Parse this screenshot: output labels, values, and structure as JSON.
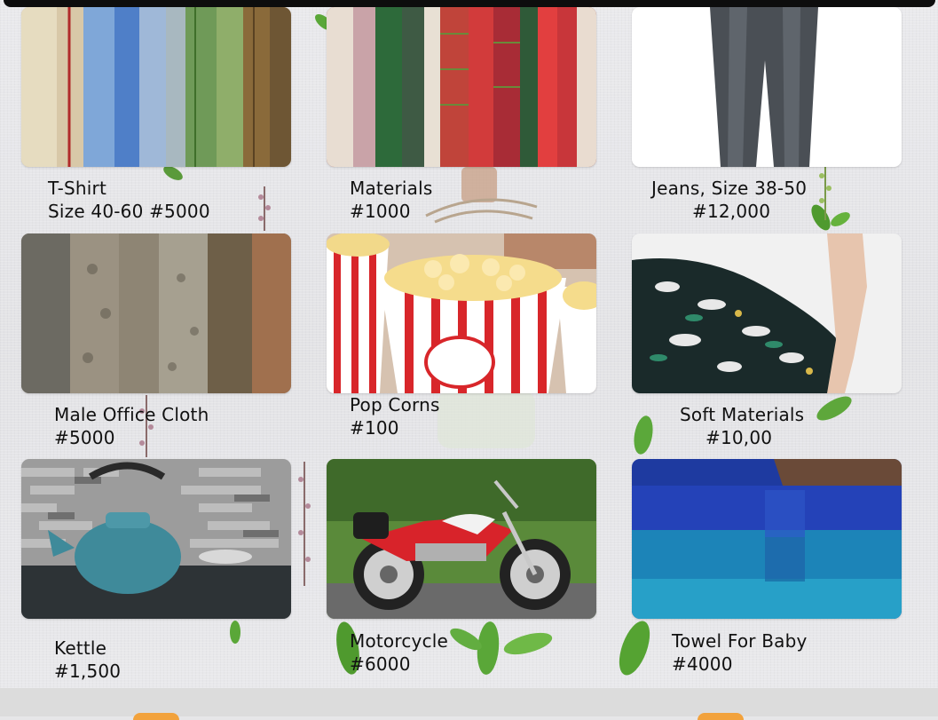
{
  "products": [
    {
      "name": "T-Shirt",
      "price": "Size 40-60 #5000",
      "image": "shirts-image"
    },
    {
      "name": "Materials",
      "price": "#1000",
      "image": "fabrics-image"
    },
    {
      "name": "Jeans, Size 38-50",
      "price": "#12,000",
      "image": "jeans-image"
    },
    {
      "name": "Male Office Cloth",
      "price": "#5000",
      "image": "office-cloth-image"
    },
    {
      "name": "Pop Corns",
      "price": "#100",
      "image": "popcorn-image"
    },
    {
      "name": "Soft Materials",
      "price": "#10,00",
      "image": "soft-materials-image"
    },
    {
      "name": "Kettle",
      "price": "#1,500",
      "image": "kettle-image"
    },
    {
      "name": "Motorcycle",
      "price": "#6000",
      "image": "motorcycle-image"
    },
    {
      "name": "Towel For Baby",
      "price": "#4000",
      "image": "towel-image"
    }
  ],
  "colors": {
    "accent": "#f2a23c",
    "background": "#e6e6e8",
    "text": "#111111"
  }
}
